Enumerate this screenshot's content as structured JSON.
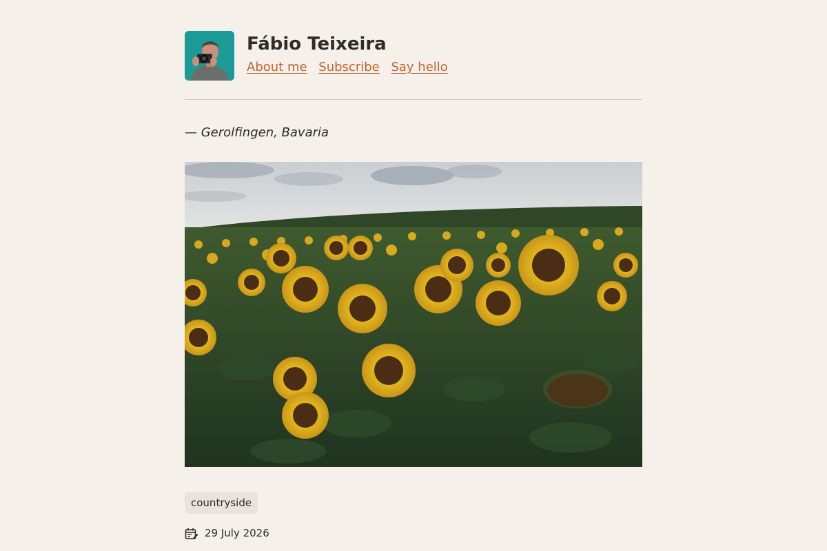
{
  "site": {
    "author_name": "Fábio Teixeira",
    "nav": [
      {
        "label": "About me",
        "icon": ""
      },
      {
        "label": "Subscribe",
        "icon": ""
      },
      {
        "label": "Say hello",
        "icon": ""
      }
    ]
  },
  "post": {
    "location": "— Gerolfingen, Bavaria",
    "tags": [
      "countryside"
    ],
    "date": "29 July 2026",
    "date_icon": "calendar-edit-icon"
  },
  "colors": {
    "background": "#f5f0e9",
    "link": "#c0632d",
    "text": "#2d2a26",
    "tag_bg": "#e8e3dc",
    "avatar_bg": "#1c9a98"
  }
}
